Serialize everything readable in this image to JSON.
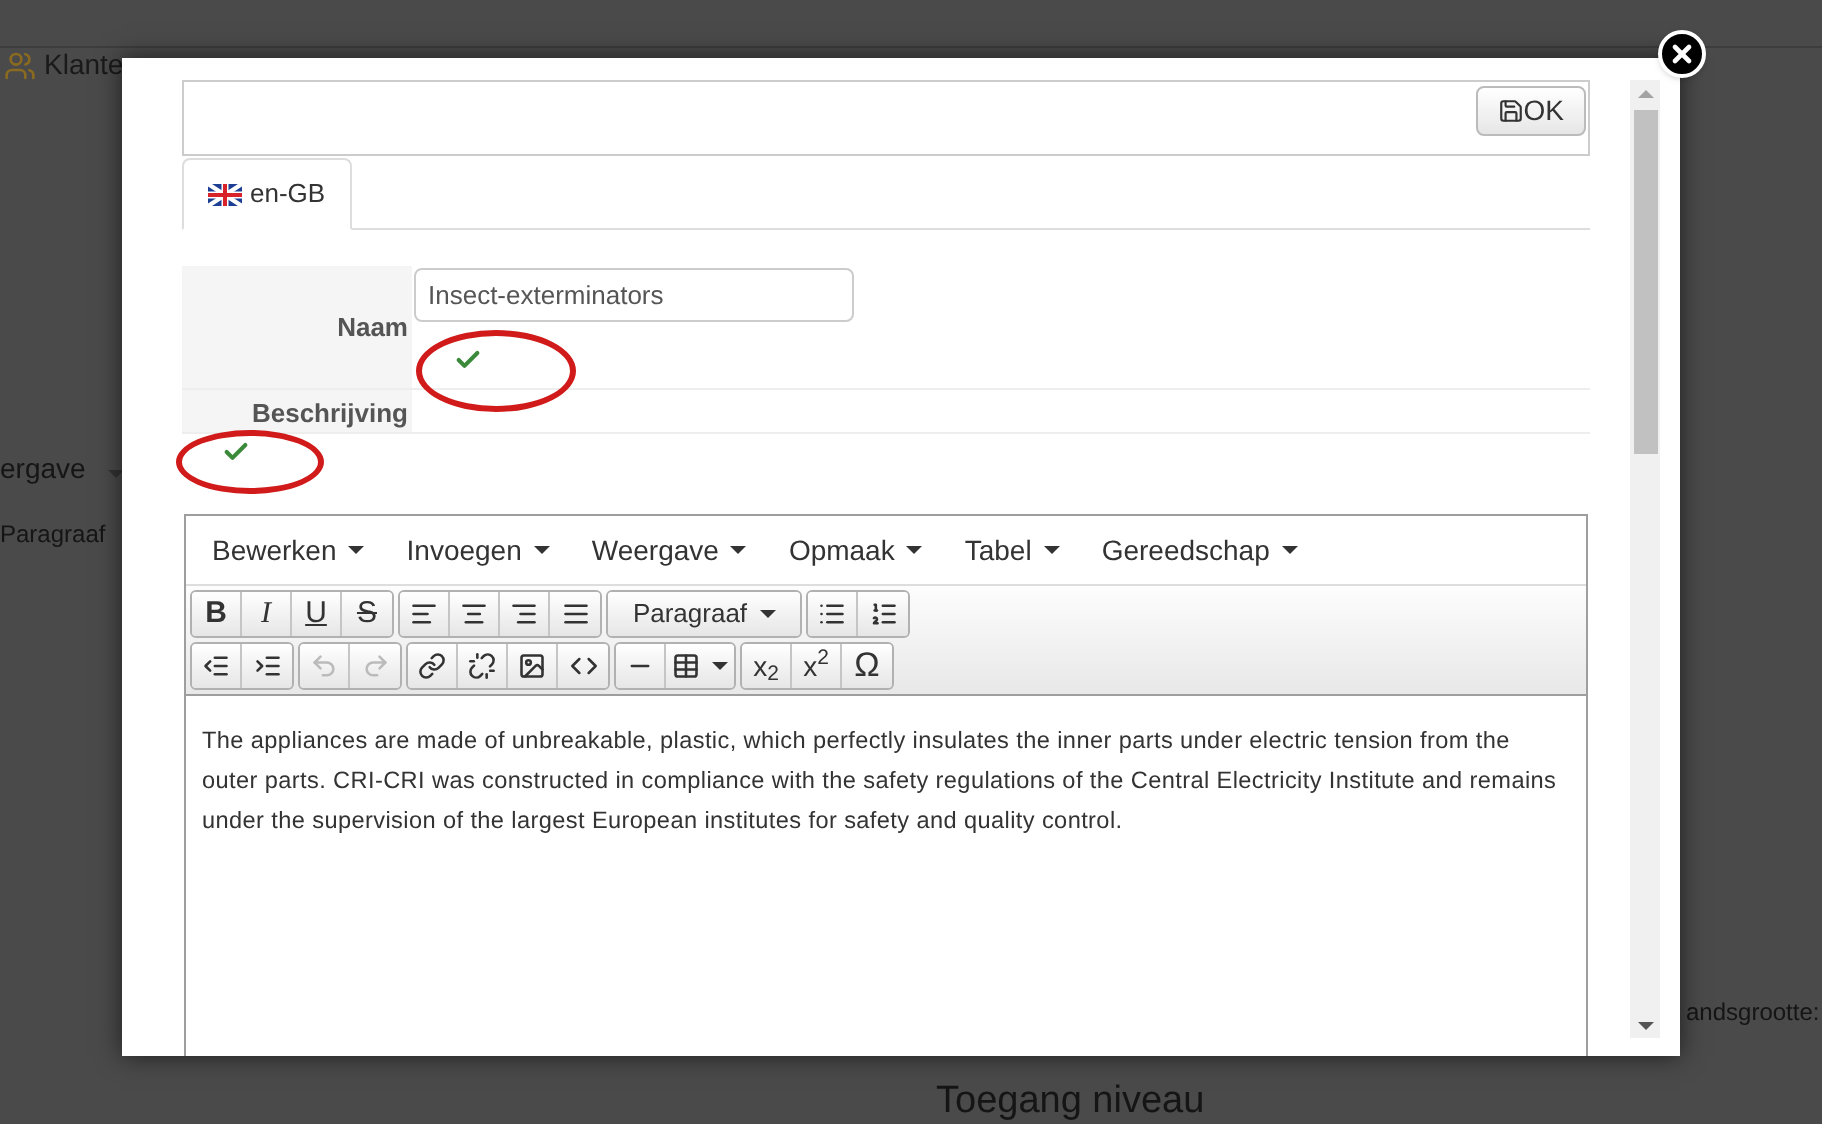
{
  "background_page": {
    "nav_item": "Klante",
    "menu_fragment": "ergave",
    "format_fragment": "Paragraaf",
    "field_label_fragment": "andsgrootte:",
    "section_heading": "Toegang niveau"
  },
  "dialog": {
    "ok_button": "OK",
    "tabs": [
      {
        "label": "en-GB",
        "selected": true
      }
    ],
    "fields": [
      {
        "label": "Naam",
        "value": "Insect-exterminators",
        "valid": true,
        "circled": true
      },
      {
        "label": "Beschrijving",
        "valid": true,
        "circled": true
      }
    ],
    "editor": {
      "menus": [
        "Bewerken",
        "Invoegen",
        "Weergave",
        "Opmaak",
        "Tabel",
        "Gereedschap"
      ],
      "toolbar_rows": [
        [
          [
            {
              "kind": "letter",
              "label": "B"
            },
            {
              "kind": "letter",
              "label": "I"
            },
            {
              "kind": "letter",
              "label": "U"
            },
            {
              "kind": "letter",
              "label": "S"
            }
          ],
          [
            {
              "kind": "icon",
              "disabled": false
            },
            {
              "kind": "icon",
              "disabled": false
            },
            {
              "kind": "icon",
              "disabled": false
            },
            {
              "kind": "icon",
              "disabled": false
            }
          ],
          [
            {
              "kind": "select",
              "label": "Paragraaf"
            }
          ],
          [
            {
              "kind": "icon",
              "disabled": false
            },
            {
              "kind": "icon",
              "disabled": false
            }
          ]
        ],
        [
          [
            {
              "kind": "icon",
              "disabled": false
            },
            {
              "kind": "icon",
              "disabled": false
            }
          ],
          [
            {
              "kind": "icon",
              "disabled": true
            },
            {
              "kind": "icon",
              "disabled": true
            }
          ],
          [
            {
              "kind": "icon",
              "disabled": false
            },
            {
              "kind": "icon",
              "disabled": false
            },
            {
              "kind": "icon",
              "disabled": false
            },
            {
              "kind": "icon",
              "disabled": false
            }
          ],
          [
            {
              "kind": "icon",
              "disabled": false
            },
            {
              "kind": "dropdown",
              "disabled": false
            }
          ],
          [
            {
              "kind": "script",
              "label": "x$_{2}$"
            },
            {
              "kind": "script",
              "label": "x$^{2}$"
            },
            {
              "kind": "letter",
              "label": "Ω"
            }
          ]
        ]
      ],
      "content": "The appliances are made of unbreakable, plastic, which perfectly insulates the inner parts under electric tension from the outer parts. CRI-CRI was constructed in compliance with the safety regulations of the Central Electricity Institute and remains under the supervision of the largest European institutes for safety and quality control."
    }
  }
}
